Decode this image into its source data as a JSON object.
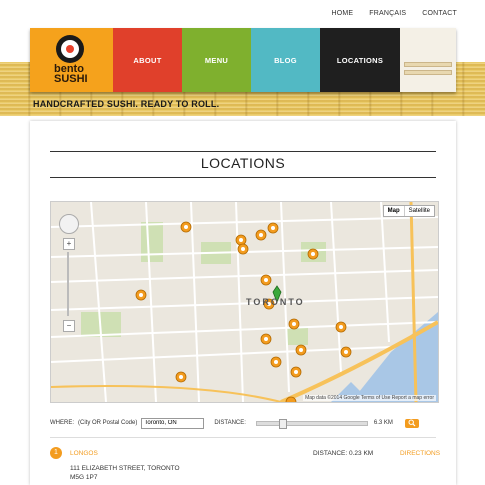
{
  "top_nav": [
    "HOME",
    "FRANÇAIS",
    "CONTACT"
  ],
  "logo": {
    "line1": "bento",
    "line2": "SUSHI"
  },
  "main_nav": [
    "ABOUT",
    "MENU",
    "BLOG",
    "LOCATIONS"
  ],
  "tagline": "HANDCRAFTED SUSHI. READY TO ROLL.",
  "page_title": "LOCATIONS",
  "map": {
    "type_buttons": [
      "Map",
      "Satellite"
    ],
    "city_label": "TORONTO",
    "footer": "Map data ©2014 Google   Terms of Use   Report a map error"
  },
  "search": {
    "where_label": "WHERE:",
    "where_hint": "(City OR Postal Code)",
    "where_value": "Toronto, ON",
    "distance_label": "DISTANCE:",
    "distance_value": "6.3 KM"
  },
  "results": [
    {
      "number": "1",
      "name": "LONGOS",
      "distance": "DISTANCE: 0.23 KM",
      "directions": "DIRECTIONS",
      "address1": "111 ELIZABETH STREET, TORONTO",
      "address2": "M5G 1P7"
    }
  ],
  "colors": {
    "orange": "#f39c1f",
    "about": "#e0402b",
    "menu": "#7fb02e",
    "blog": "#52b9c4",
    "locations": "#1f1f1f"
  }
}
